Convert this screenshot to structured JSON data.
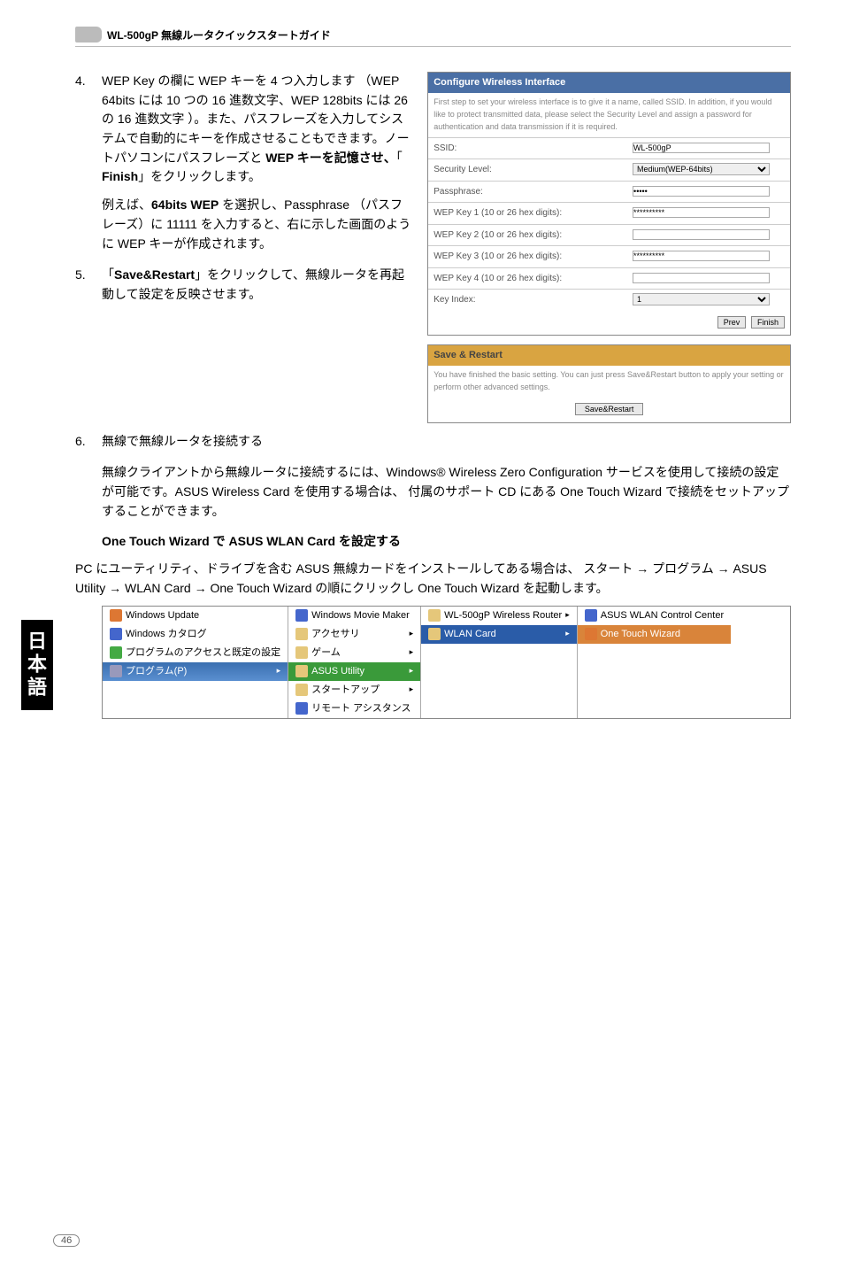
{
  "header": {
    "product_line": "WL-500gP 無線ルータクイックスタートガイド"
  },
  "side_tab": "日本語",
  "step4": {
    "num": "4.",
    "body_a": "WEP Key の欄に WEP キーを 4 つ入力します （WEP 64bits には 10 つの 16 進数文字、WEP 128bits には 26 の 16 進数文字 ）。また、パスフレーズを入力してシステムで自動的にキーを作成させることもできます。ノートパソコンにパスフレーズと ",
    "body_b_bold": "WEP キーを記憶させ、",
    "body_c": "「 ",
    "body_d_bold": "Finish",
    "body_e": "」をクリックします。",
    "example_a": "例えば、",
    "example_b_bold": "64bits WEP",
    "example_c": "  を選択し、Passphrase （パスフレーズ）に 11111 を入力すると、右に示した画面のように WEP キーが作成されます。"
  },
  "step5": {
    "num": "5.",
    "body_a": "「",
    "body_b_bold": "Save&Restart",
    "body_c": "」をクリックして、無線ルータを再起動して設定を反映させます。"
  },
  "step6": {
    "num": "6.",
    "body": "無線で無線ルータを接続する",
    "desc": "無線クライアントから無線ルータに接続するには、Windows® Wireless Zero Configuration サービスを使用して接続の設定が可能です。ASUS Wireless Card を使用する場合は、 付属のサポート CD にある One Touch Wizard で接続をセットアップすることができます。",
    "sub_heading": "One Touch Wizard で ASUS WLAN Card を設定する",
    "sub_body": "PC にユーティリティ、ドライブを含む ASUS 無線カードをインストールしてある場合は、 スタート → プログラム → ASUS Utility → WLAN Card → One Touch Wizard の順にクリックし One Touch Wizard を起動します。"
  },
  "config_panel": {
    "title": "Configure Wireless Interface",
    "desc": "First step to set your wireless interface is to give it a name, called SSID. In addition, if you would like to protect transmitted data, please select the Security Level and assign a password for authentication and data transmission if it is required.",
    "rows": {
      "ssid_l": "SSID:",
      "ssid_v": "WL-500gP",
      "sec_l": "Security Level:",
      "sec_v": "Medium(WEP-64bits)",
      "pass_l": "Passphrase:",
      "pass_v": "•••••",
      "k1_l": "WEP Key 1 (10 or 26 hex digits):",
      "k1_v": "**********",
      "k2_l": "WEP Key 2 (10 or 26 hex digits):",
      "k2_v": "",
      "k3_l": "WEP Key 3 (10 or 26 hex digits):",
      "k3_v": "**********",
      "k4_l": "WEP Key 4 (10 or 26 hex digits):",
      "k4_v": "",
      "idx_l": "Key Index:",
      "idx_v": "1"
    },
    "btn_prev": "Prev",
    "btn_finish": "Finish"
  },
  "restart_panel": {
    "title": "Save & Restart",
    "desc": "You have finished the basic setting. You can just press Save&Restart button to apply your setting or perform other advanced settings.",
    "btn": "Save&Restart"
  },
  "start_menu": {
    "col0": {
      "update": "Windows Update",
      "catalog": "Windows カタログ",
      "access": "プログラムのアクセスと既定の設定",
      "programs": "プログラム(P)"
    },
    "col1": {
      "movie": "Windows Movie Maker",
      "acc": "アクセサリ",
      "game": "ゲーム",
      "asus": "ASUS Utility",
      "startup": "スタートアップ",
      "remote": "リモート アシスタンス"
    },
    "col2": {
      "router": "WL-500gP Wireless Router",
      "card": "WLAN Card"
    },
    "col3": {
      "cc": "ASUS WLAN Control Center",
      "otw": "One Touch Wizard"
    }
  },
  "page_number": "46"
}
